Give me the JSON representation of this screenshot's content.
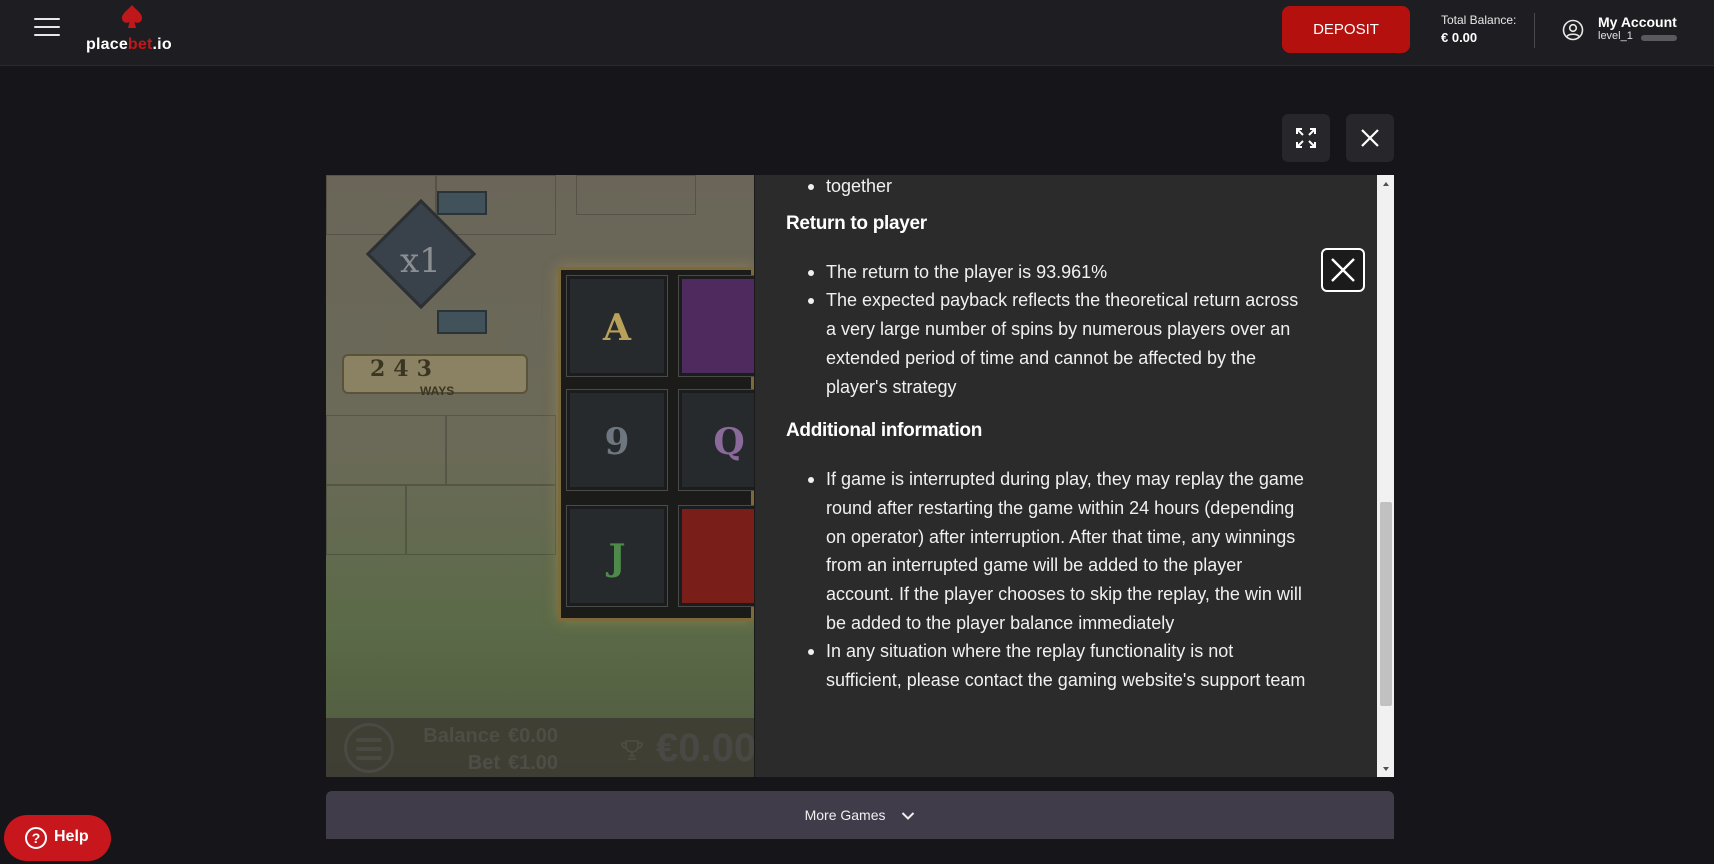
{
  "header": {
    "logo_prefix": "place",
    "logo_highlight": "bet",
    "logo_suffix": ".io",
    "deposit_label": "DEPOSIT",
    "balance_label": "Total Balance:",
    "balance_value": "€ 0.00",
    "account_name": "My Account",
    "account_level": "level_1"
  },
  "game": {
    "multiplier": "x1",
    "ways_count": "243",
    "ways_label": "WAYS",
    "symbols": [
      "A",
      "9",
      "Q",
      "J"
    ],
    "balance_label": "Balance",
    "balance_value": "€0.00",
    "bet_label": "Bet",
    "bet_value": "€1.00",
    "win_value": "€0.00"
  },
  "info": {
    "top_fragment": "together",
    "rtp_heading": "Return to player",
    "rtp_items": [
      "The return to the player is 93.961%",
      "The expected payback reflects the theoretical return across a very large number of spins by numerous players over an extended period of time and cannot be affected by the player's strategy"
    ],
    "additional_heading": "Additional information",
    "additional_items": [
      "If game is interrupted during play, they may replay the game round after restarting the game within 24 hours (depending on operator) after interruption. After that time, any winnings from an interrupted game will be added to the player account. If the player chooses to skip the replay, the win will be added to the player balance immediately",
      "In any situation where the replay functionality is not sufficient, please contact the gaming website's support team"
    ]
  },
  "footer": {
    "more_games_label": "More Games",
    "help_label": "Help"
  },
  "colors": {
    "accent": "#b3100e",
    "page_bg": "#161519",
    "header_bg": "#1e1d21",
    "panel_bg": "#2b2b2b",
    "more_games_bg": "#403c4a"
  },
  "icons": [
    "menu-icon",
    "spade-icon",
    "user-icon",
    "fullscreen-icon",
    "close-icon",
    "trophy-icon",
    "chevron-down-icon",
    "question-icon"
  ]
}
